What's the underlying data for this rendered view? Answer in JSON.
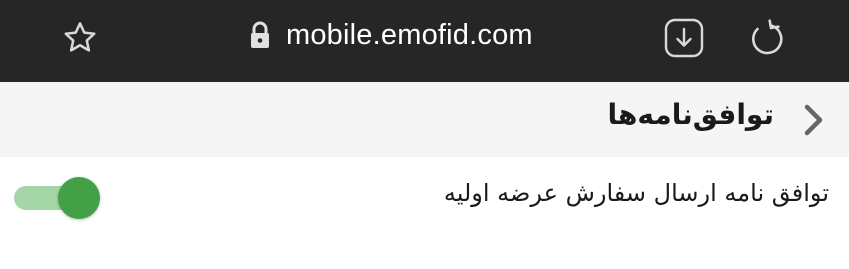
{
  "browser": {
    "url": "mobile.emofid.com",
    "icons": {
      "bookmark": "star-icon",
      "secure": "lock-icon",
      "download": "download-icon",
      "reload": "reload-icon"
    }
  },
  "header": {
    "title": "توافق‌نامه‌ها",
    "back_icon": "chevron-right-icon"
  },
  "settings": {
    "items": [
      {
        "label": "توافق نامه ارسال سفارش عرضه اولیه",
        "enabled": true
      }
    ]
  },
  "colors": {
    "browser_bar": "#262626",
    "header_bg": "#f5f5f5",
    "toggle_on_thumb": "#43a047",
    "toggle_on_track": "#a5d6a7"
  }
}
